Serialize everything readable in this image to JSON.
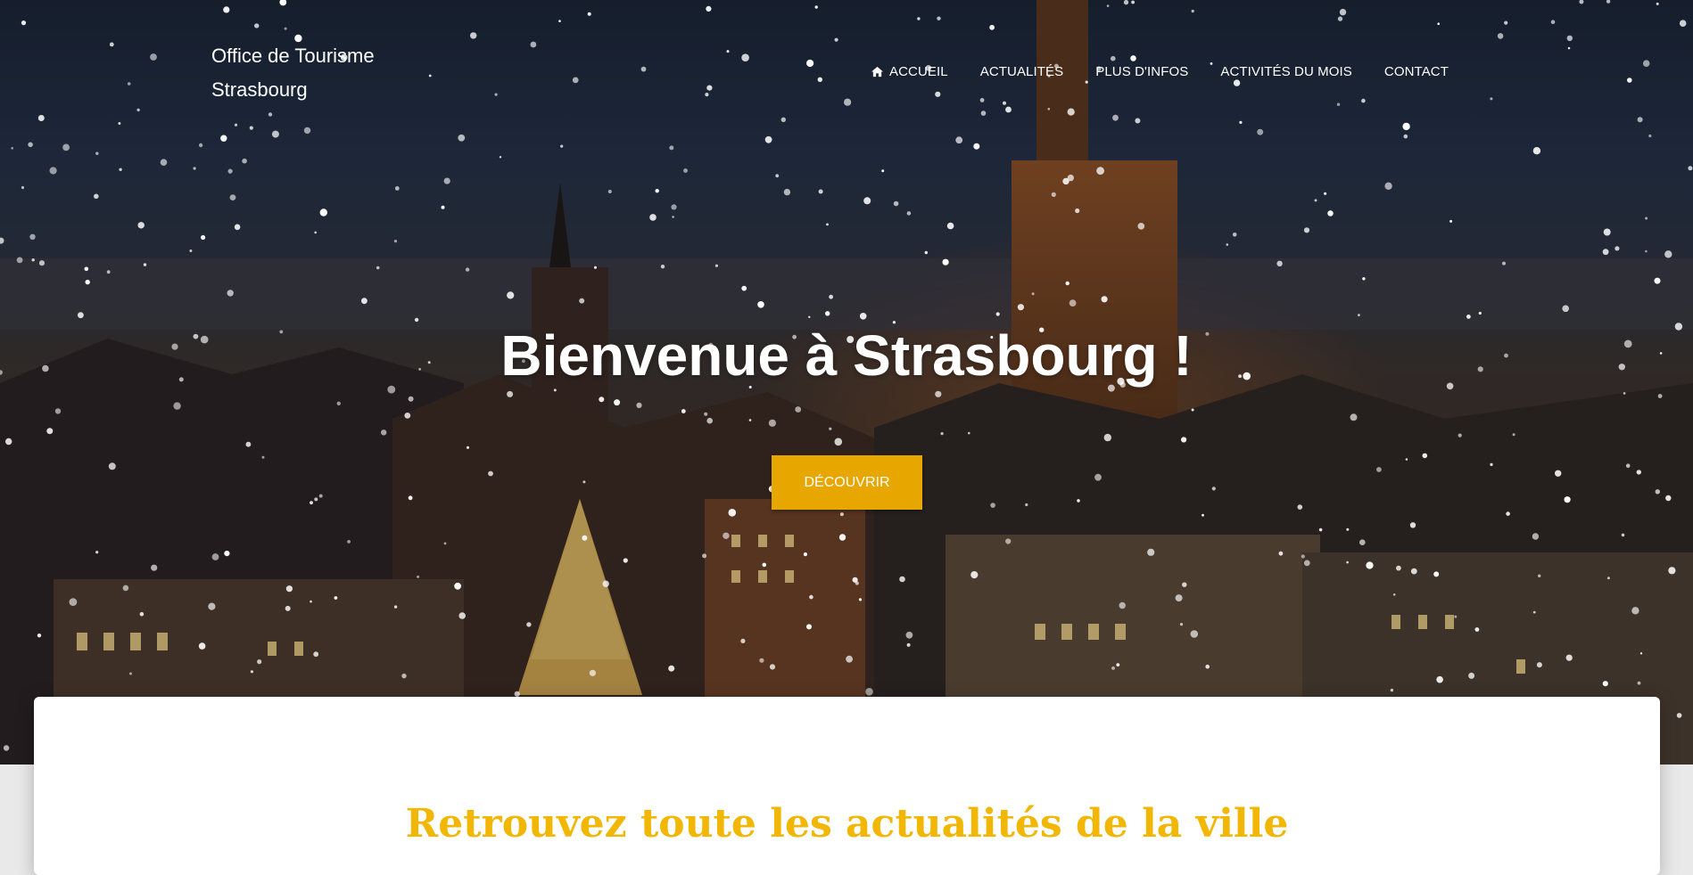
{
  "brand": {
    "line1": "Office de Tourisme",
    "line2": "Strasbourg"
  },
  "nav": {
    "items": [
      {
        "label": "ACCUEIL",
        "icon": "home-icon"
      },
      {
        "label": "ACTUALITÉS"
      },
      {
        "label": "PLUS D'INFOS"
      },
      {
        "label": "ACTIVITÉS DU MOIS"
      },
      {
        "label": "CONTACT"
      }
    ]
  },
  "hero": {
    "title": "Bienvenue à Strasbourg !",
    "cta_label": "DÉCOUVRIR",
    "background": "night-city-snow-photo"
  },
  "section": {
    "title": "Retrouvez toute les actualités de la ville"
  },
  "colors": {
    "accent": "#e8a600",
    "section_title": "#f2b705",
    "nav_text": "#ffffff"
  }
}
